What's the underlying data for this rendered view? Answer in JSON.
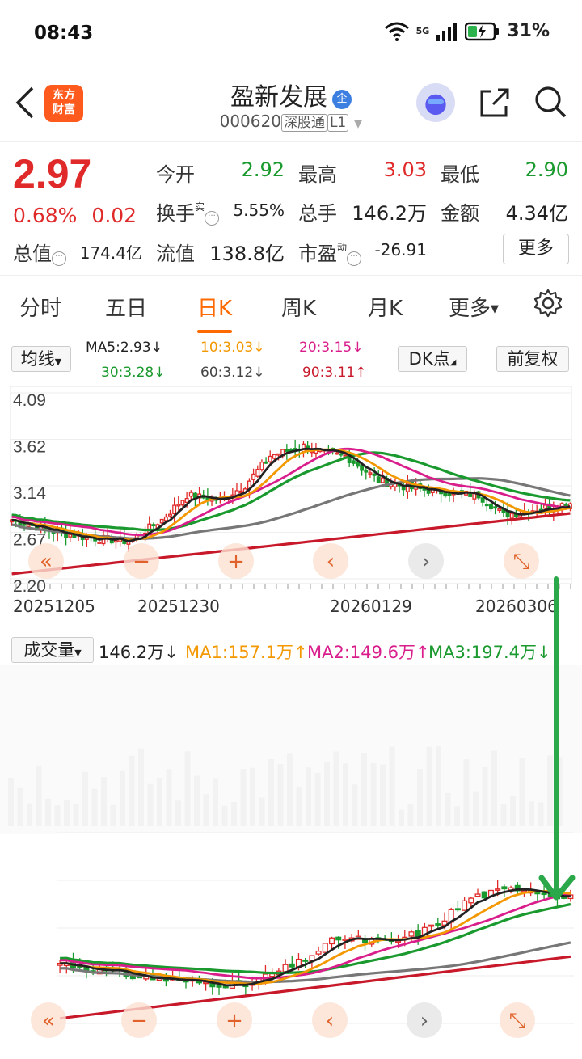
{
  "status": {
    "time": "08:43",
    "network": "5G",
    "battery": "31%"
  },
  "header": {
    "logo_line1": "东方",
    "logo_line2": "财富",
    "name": "盈新发展",
    "ent_badge": "企",
    "code": "000620",
    "exchange_tag": "深股通",
    "level_tag": "L1"
  },
  "quote": {
    "price": "2.97",
    "change_pct": "0.68%",
    "change_amt": "0.02",
    "open_label": "今开",
    "open": "2.92",
    "high_label": "最高",
    "high": "3.03",
    "low_label": "最低",
    "low": "2.90",
    "turnover_label": "换手",
    "turnover_sup": "实",
    "turnover": "5.55%",
    "volume_label": "总手",
    "volume": "146.2万",
    "amount_label": "金额",
    "amount": "4.34亿",
    "mktcap_label": "总值",
    "mktcap": "174.4亿",
    "float_label": "流值",
    "float": "138.8亿",
    "pe_label": "市盈",
    "pe_sup": "动",
    "pe": "-26.91",
    "more_label": "更多"
  },
  "tabs": [
    "分时",
    "五日",
    "日K",
    "周K",
    "月K",
    "更多"
  ],
  "active_tab": "日K",
  "ma": {
    "selector": "均线",
    "ma5": "MA5:2.93↓",
    "ma10": "10:3.03↓",
    "ma20": "20:3.15↓",
    "ma30": "30:3.28↓",
    "ma60": "60:3.12↓",
    "ma90": "90:3.11↑",
    "dk_label": "DK点",
    "adjust_label": "前复权",
    "colors": {
      "ma5": "#222222",
      "ma10": "#f39800",
      "ma20": "#d91e8c",
      "ma30": "#1a9a2e",
      "ma60": "#777777",
      "ma90": "#c8192b"
    }
  },
  "chart_data": {
    "type": "candlestick",
    "y_ticks": [
      "4.09",
      "3.62",
      "3.14",
      "2.67",
      "2.20"
    ],
    "ylim": [
      2.2,
      4.09
    ],
    "x_ticks": [
      "20251205",
      "20251230",
      "20260129",
      "20260306"
    ],
    "last_close": 2.97
  },
  "volume": {
    "selector": "成交量",
    "current": "146.2万↓",
    "ma1": "MA1:157.1万↑",
    "ma2": "MA2:149.6万↑",
    "ma3": "MA3:197.4万↓"
  }
}
